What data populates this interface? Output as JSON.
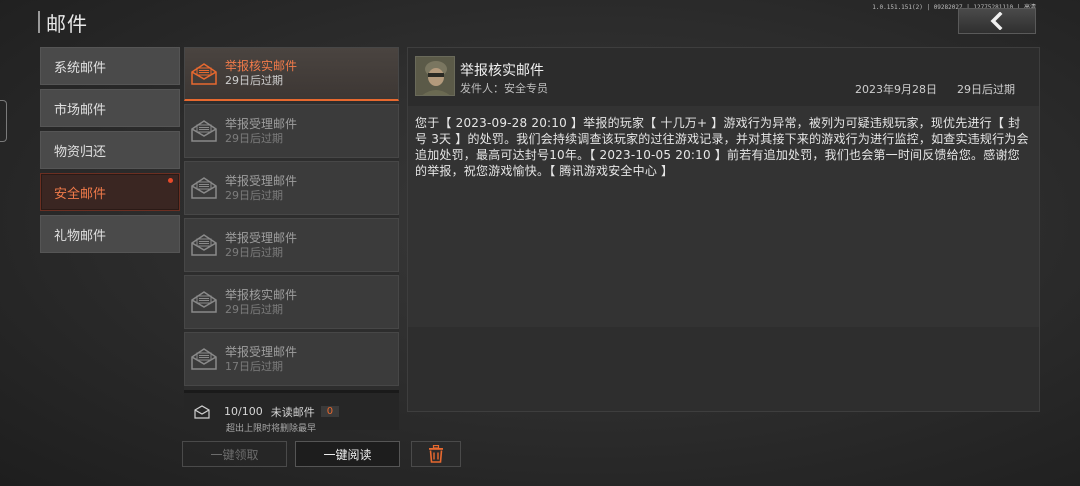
{
  "header": {
    "title": "邮件",
    "version": "1.0.151.151(2) | 09282027 | 12775281110 | 高清"
  },
  "categories": [
    {
      "label": "系统邮件",
      "active": false
    },
    {
      "label": "市场邮件",
      "active": false
    },
    {
      "label": "物资归还",
      "active": false
    },
    {
      "label": "安全邮件",
      "active": true
    },
    {
      "label": "礼物邮件",
      "active": false
    }
  ],
  "mails": [
    {
      "name": "举报核实邮件",
      "expiry": "29日后过期"
    },
    {
      "name": "举报受理邮件",
      "expiry": "29日后过期"
    },
    {
      "name": "举报受理邮件",
      "expiry": "29日后过期"
    },
    {
      "name": "举报受理邮件",
      "expiry": "29日后过期"
    },
    {
      "name": "举报核实邮件",
      "expiry": "29日后过期"
    },
    {
      "name": "举报受理邮件",
      "expiry": "17日后过期"
    }
  ],
  "footer": {
    "count": "10/100",
    "unread_label": "未读邮件",
    "unread_count": "0",
    "warning": "超出上限时将删除最早"
  },
  "actions": {
    "claim_all": "一键领取",
    "read_all": "一键阅读"
  },
  "detail": {
    "title": "举报核实邮件",
    "sender": "发件人：安全专员",
    "date": "2023年9月28日",
    "expiry": "29日后过期",
    "body": "您于【 2023-09-28 20:10 】举报的玩家【 十几万+ 】游戏行为异常，被列为可疑违规玩家，现优先进行【 封号 3天 】的处罚。我们会持续调查该玩家的过往游戏记录，并对其接下来的游戏行为进行监控，如查实违规行为会追加处罚，最高可达封号10年。【 2023-10-05 20:10 】前若有追加处罚，我们也会第一时间反馈给您。感谢您的举报，祝您游戏愉快。【 腾讯游戏安全中心 】"
  },
  "colors": {
    "accent": "#e8692f",
    "badge_dot": "#e84a2a"
  },
  "icons": {
    "back": "chevron-left-icon",
    "mail": "envelope-icon",
    "delete": "trash-icon"
  }
}
